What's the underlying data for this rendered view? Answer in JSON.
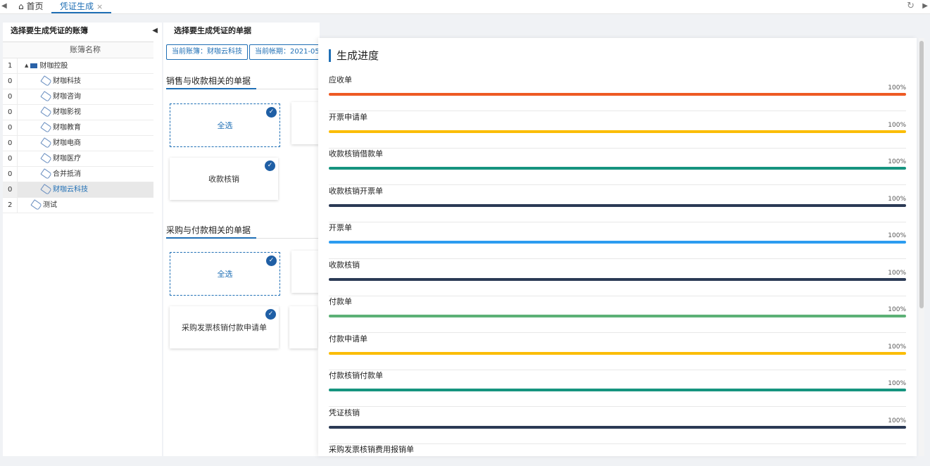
{
  "tabs": {
    "home_label": "首页",
    "voucher_label": "凭证生成",
    "close_glyph": "×"
  },
  "left": {
    "title": "选择要生成凭证的账簿",
    "column_header": "账簿名称",
    "rows": [
      {
        "num": "1",
        "label": "财咖控股",
        "type": "folder"
      },
      {
        "num": "0",
        "label": "财咖科技",
        "type": "tag"
      },
      {
        "num": "0",
        "label": "财咖咨询",
        "type": "tag"
      },
      {
        "num": "0",
        "label": "财咖影视",
        "type": "tag"
      },
      {
        "num": "0",
        "label": "财咖教育",
        "type": "tag"
      },
      {
        "num": "0",
        "label": "财咖电商",
        "type": "tag"
      },
      {
        "num": "0",
        "label": "财咖医疗",
        "type": "tag"
      },
      {
        "num": "0",
        "label": "合并抵消",
        "type": "tag"
      },
      {
        "num": "0",
        "label": "财咖云科技",
        "type": "tag",
        "selected": true
      },
      {
        "num": "2",
        "label": "测试",
        "type": "tag"
      }
    ]
  },
  "middle": {
    "title": "选择要生成凭证的单据",
    "current_book": "当前账簿：财咖云科技",
    "current_period": "当前帐期：2021-05",
    "section_sales": "销售与收款相关的单据",
    "section_purchase": "采购与付款相关的单据",
    "select_all": "全选",
    "card_collect": "收款核销",
    "card_purchase": "采购发票核销付款申请单"
  },
  "progress": {
    "title": "生成进度",
    "items": [
      {
        "label": "应收单",
        "pct_text": "100%",
        "fraction": 1.0,
        "color": "#ee5a24"
      },
      {
        "label": "开票申请单",
        "pct_text": "100%",
        "fraction": 1.0,
        "color": "#fbbd08"
      },
      {
        "label": "收款核销借款单",
        "pct_text": "100%",
        "fraction": 1.0,
        "color": "#16947f"
      },
      {
        "label": "收款核销开票单",
        "pct_text": "100%",
        "fraction": 1.0,
        "color": "#2b3a55"
      },
      {
        "label": "开票单",
        "pct_text": "100%",
        "fraction": 1.0,
        "color": "#2d9cf0"
      },
      {
        "label": "收款核销",
        "pct_text": "100%",
        "fraction": 1.0,
        "color": "#2b3a55"
      },
      {
        "label": "付款单",
        "pct_text": "100%",
        "fraction": 1.0,
        "color": "#5cb176"
      },
      {
        "label": "付款申请单",
        "pct_text": "100%",
        "fraction": 1.0,
        "color": "#fbbd08"
      },
      {
        "label": "付款核销付款单",
        "pct_text": "100%",
        "fraction": 1.0,
        "color": "#16947f"
      },
      {
        "label": "凭证核销",
        "pct_text": "100%",
        "fraction": 1.0,
        "color": "#2b3a55"
      },
      {
        "label": "采购发票核销费用报销单",
        "pct_text": "",
        "fraction": 0,
        "color": "#2b3a55"
      }
    ]
  }
}
